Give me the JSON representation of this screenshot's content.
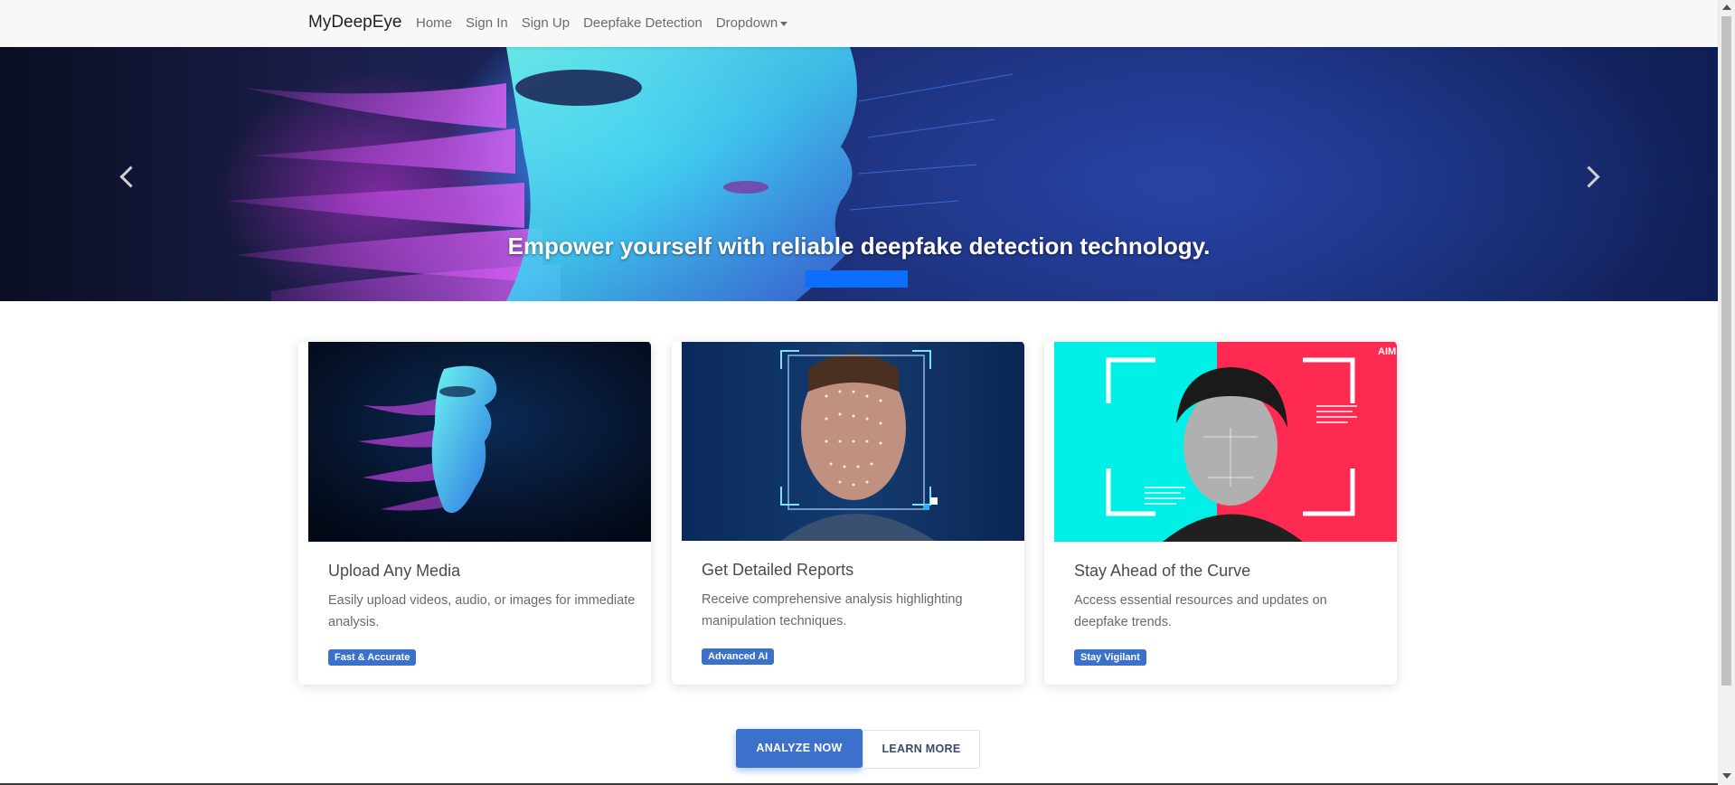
{
  "navbar": {
    "brand": "MyDeepEye",
    "links": [
      "Home",
      "Sign In",
      "Sign Up",
      "Deepfake Detection"
    ],
    "dropdown_label": "Dropdown"
  },
  "carousel": {
    "caption": "Empower yourself with reliable deepfake detection technology.",
    "prev_icon": "chevron-left-icon",
    "next_icon": "chevron-right-icon",
    "indicator_color": "#0d6efd"
  },
  "cards": [
    {
      "title": "Upload Any Media",
      "text": "Easily upload videos, audio, or images for immediate analysis.",
      "badge": "Fast & Accurate"
    },
    {
      "title": "Get Detailed Reports",
      "text": "Receive comprehensive analysis highlighting manipulation techniques.",
      "badge": "Advanced AI"
    },
    {
      "title": "Stay Ahead of the Curve",
      "text": "Access essential resources and updates on deepfake trends.",
      "badge": "Stay Vigilant"
    }
  ],
  "card3_logo": "AIM",
  "buttons": {
    "primary": "ANALYZE NOW",
    "secondary": "LEARN MORE"
  },
  "colors": {
    "accent": "#3b71ca",
    "card3_cyan": "#00f0e8",
    "card3_red": "#ff2a52"
  }
}
